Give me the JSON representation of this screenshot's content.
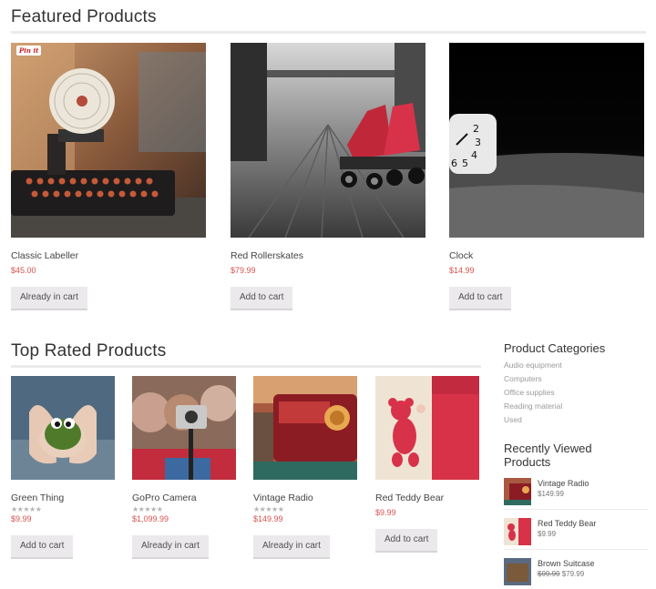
{
  "featured": {
    "title": "Featured Products",
    "pin_label": "Pin it",
    "products": [
      {
        "name": "Classic Labeller",
        "price": "$45.00",
        "button": "Already in cart"
      },
      {
        "name": "Red Rollerskates",
        "price": "$79.99",
        "button": "Add to cart"
      },
      {
        "name": "Clock",
        "price": "$14.99",
        "button": "Add to cart"
      }
    ]
  },
  "top_rated": {
    "title": "Top Rated Products",
    "stars": "★★★★★",
    "products": [
      {
        "name": "Green Thing",
        "price": "$9.99",
        "button": "Add to cart",
        "rated": true
      },
      {
        "name": "GoPro Camera",
        "price": "$1,099.99",
        "button": "Already in cart",
        "rated": true
      },
      {
        "name": "Vintage Radio",
        "price": "$149.99",
        "button": "Already in cart",
        "rated": true
      },
      {
        "name": "Red Teddy Bear",
        "price": "$9.99",
        "button": "Add to cart",
        "rated": false
      }
    ]
  },
  "sidebar": {
    "categories_title": "Product Categories",
    "categories": [
      "Audio equipment",
      "Computers",
      "Office supplies",
      "Reading material",
      "Used"
    ],
    "recent_title_1": "Recently Viewed",
    "recent_title_2": "Products",
    "recent": [
      {
        "name": "Vintage Radio",
        "price": "$149.99"
      },
      {
        "name": "Red Teddy Bear",
        "price": "$9.99"
      },
      {
        "name": "Brown Suitcase",
        "old_price": "$99.99",
        "price": "$79.99"
      }
    ]
  },
  "colors": {
    "price": "#d9534f",
    "button_bg": "#ebe9eb",
    "rule": "#ebebeb"
  }
}
